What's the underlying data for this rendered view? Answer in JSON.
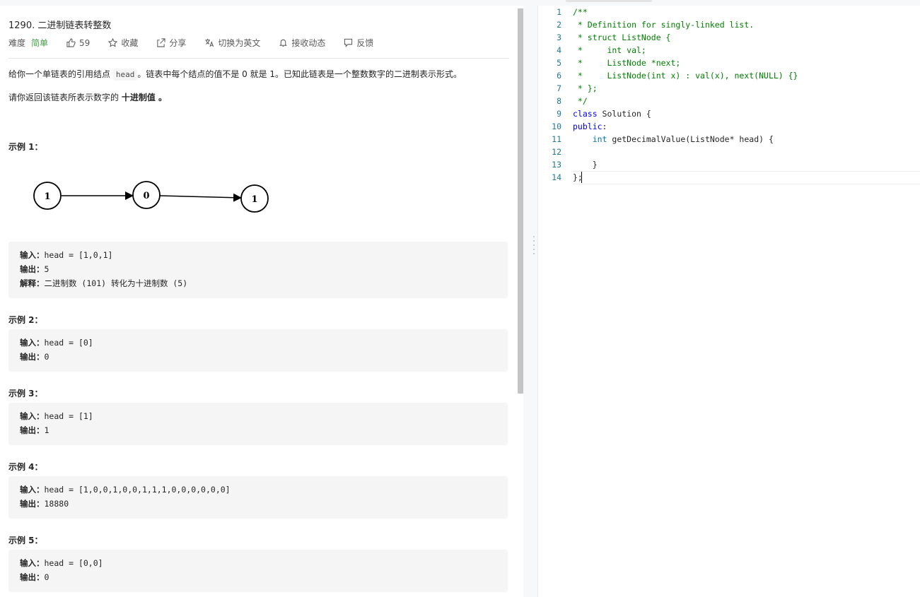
{
  "problem": {
    "title": "1290. 二进制链表转整数",
    "difficulty_label": "难度",
    "difficulty_value": "简单",
    "likes": "59",
    "favorite": "收藏",
    "share": "分享",
    "switch_lang": "切换为英文",
    "subscribe": "接收动态",
    "feedback": "反馈",
    "desc1_a": "给你一个单链表的引用结点 ",
    "desc1_code": "head",
    "desc1_b": "。链表中每个结点的值不是 0 就是 1。已知此链表是一个整数数字的二进制表示形式。",
    "desc2_a": "请你返回该链表所表示数字的 ",
    "desc2_bold": "十进制值",
    "desc2_b": " 。"
  },
  "diagram": {
    "nodes": [
      "1",
      "0",
      "1"
    ]
  },
  "examples": [
    {
      "heading": "示例 1：",
      "lines": [
        {
          "label": "输入：",
          "value": "head = [1,0,1]"
        },
        {
          "label": "输出：",
          "value": "5"
        },
        {
          "label": "解释：",
          "value": "二进制数 (101) 转化为十进制数 (5)"
        }
      ]
    },
    {
      "heading": "示例 2：",
      "lines": [
        {
          "label": "输入：",
          "value": "head = [0]"
        },
        {
          "label": "输出：",
          "value": "0"
        }
      ]
    },
    {
      "heading": "示例 3：",
      "lines": [
        {
          "label": "输入：",
          "value": "head = [1]"
        },
        {
          "label": "输出：",
          "value": "1"
        }
      ]
    },
    {
      "heading": "示例 4：",
      "lines": [
        {
          "label": "输入：",
          "value": "head = [1,0,0,1,0,0,1,1,1,0,0,0,0,0,0]"
        },
        {
          "label": "输出：",
          "value": "18880"
        }
      ]
    },
    {
      "heading": "示例 5：",
      "lines": [
        {
          "label": "输入：",
          "value": "head = [0,0]"
        },
        {
          "label": "输出：",
          "value": "0"
        }
      ]
    }
  ],
  "editor": {
    "lines": [
      {
        "n": "1",
        "parts": [
          {
            "t": "/**",
            "c": "com"
          }
        ]
      },
      {
        "n": "2",
        "parts": [
          {
            "t": " * Definition for singly-linked list.",
            "c": "com"
          }
        ]
      },
      {
        "n": "3",
        "parts": [
          {
            "t": " * struct ListNode {",
            "c": "com"
          }
        ]
      },
      {
        "n": "4",
        "parts": [
          {
            "t": " *     int val;",
            "c": "com"
          }
        ]
      },
      {
        "n": "5",
        "parts": [
          {
            "t": " *     ListNode *next;",
            "c": "com"
          }
        ]
      },
      {
        "n": "6",
        "parts": [
          {
            "t": " *     ListNode(int x) : val(x), next(NULL) {}",
            "c": "com"
          }
        ]
      },
      {
        "n": "7",
        "parts": [
          {
            "t": " * };",
            "c": "com"
          }
        ]
      },
      {
        "n": "8",
        "parts": [
          {
            "t": " */",
            "c": "com"
          }
        ]
      },
      {
        "n": "9",
        "parts": [
          {
            "t": "class",
            "c": "kw"
          },
          {
            "t": " Solution {",
            "c": ""
          }
        ]
      },
      {
        "n": "10",
        "parts": [
          {
            "t": "public",
            "c": "kw"
          },
          {
            "t": ":",
            "c": ""
          }
        ]
      },
      {
        "n": "11",
        "parts": [
          {
            "t": "    ",
            "c": ""
          },
          {
            "t": "int",
            "c": "kw2"
          },
          {
            "t": " getDecimalValue(ListNode* head) {",
            "c": ""
          }
        ]
      },
      {
        "n": "12",
        "parts": [
          {
            "t": "        ",
            "c": ""
          }
        ]
      },
      {
        "n": "13",
        "parts": [
          {
            "t": "    }",
            "c": ""
          }
        ]
      },
      {
        "n": "14",
        "parts": [
          {
            "t": "};",
            "c": ""
          }
        ]
      }
    ]
  }
}
